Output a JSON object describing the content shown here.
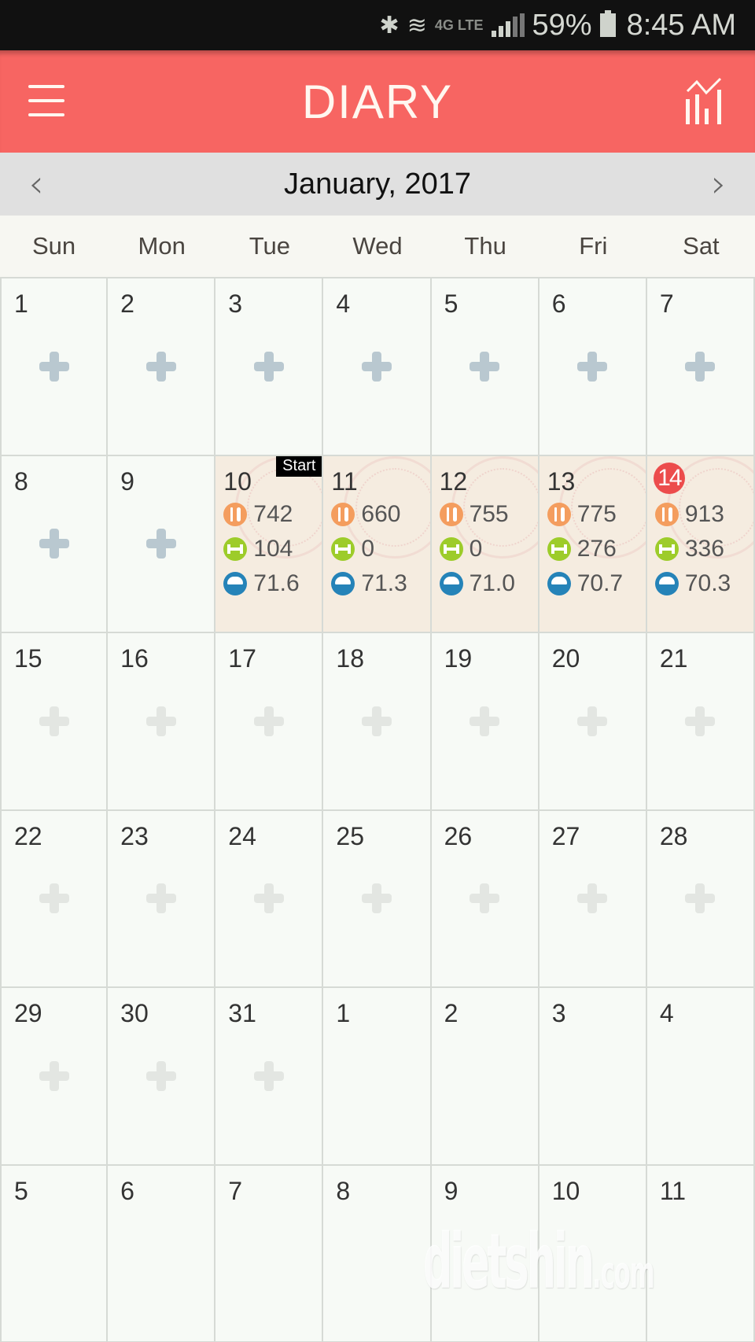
{
  "status_bar": {
    "battery": "59%",
    "time": "8:45 AM",
    "network": "4G LTE",
    "icons": [
      "bluetooth-icon",
      "wifi-icon",
      "lte-icon",
      "signal-icon",
      "battery-icon"
    ]
  },
  "app_bar": {
    "title": "DIARY",
    "menu_icon": "hamburger-menu-icon",
    "stats_icon": "bar-chart-trend-icon",
    "color": "#f76562"
  },
  "month_nav": {
    "label": "January, 2017",
    "prev": "‹",
    "next": "›"
  },
  "weekdays": [
    "Sun",
    "Mon",
    "Tue",
    "Wed",
    "Thu",
    "Fri",
    "Sat"
  ],
  "start_label": "Start",
  "today": 14,
  "cells": [
    {
      "day": "1",
      "plus": "normal"
    },
    {
      "day": "2",
      "plus": "normal"
    },
    {
      "day": "3",
      "plus": "normal"
    },
    {
      "day": "4",
      "plus": "normal"
    },
    {
      "day": "5",
      "plus": "normal"
    },
    {
      "day": "6",
      "plus": "normal"
    },
    {
      "day": "7",
      "plus": "normal"
    },
    {
      "day": "8",
      "plus": "normal"
    },
    {
      "day": "9",
      "plus": "normal"
    },
    {
      "day": "10",
      "start": true,
      "food": "742",
      "exercise": "104",
      "weight": "71.6"
    },
    {
      "day": "11",
      "food": "660",
      "exercise": "0",
      "weight": "71.3"
    },
    {
      "day": "12",
      "food": "755",
      "exercise": "0",
      "weight": "71.0"
    },
    {
      "day": "13",
      "food": "775",
      "exercise": "276",
      "weight": "70.7"
    },
    {
      "day": "14",
      "today": true,
      "food": "913",
      "exercise": "336",
      "weight": "70.3"
    },
    {
      "day": "15",
      "plus": "faded"
    },
    {
      "day": "16",
      "plus": "faded"
    },
    {
      "day": "17",
      "plus": "faded"
    },
    {
      "day": "18",
      "plus": "faded"
    },
    {
      "day": "19",
      "plus": "faded"
    },
    {
      "day": "20",
      "plus": "faded"
    },
    {
      "day": "21",
      "plus": "faded"
    },
    {
      "day": "22",
      "plus": "faded"
    },
    {
      "day": "23",
      "plus": "faded"
    },
    {
      "day": "24",
      "plus": "faded"
    },
    {
      "day": "25",
      "plus": "faded"
    },
    {
      "day": "26",
      "plus": "faded"
    },
    {
      "day": "27",
      "plus": "faded"
    },
    {
      "day": "28",
      "plus": "faded"
    },
    {
      "day": "29",
      "plus": "faded"
    },
    {
      "day": "30",
      "plus": "faded"
    },
    {
      "day": "31",
      "plus": "faded"
    },
    {
      "day": "1",
      "other": true
    },
    {
      "day": "2",
      "other": true
    },
    {
      "day": "3",
      "other": true
    },
    {
      "day": "4",
      "other": true
    },
    {
      "day": "5",
      "other": true
    },
    {
      "day": "6",
      "other": true
    },
    {
      "day": "7",
      "other": true
    },
    {
      "day": "8",
      "other": true
    },
    {
      "day": "9",
      "other": true
    },
    {
      "day": "10",
      "other": true
    },
    {
      "day": "11",
      "other": true
    }
  ],
  "watermark": {
    "main": "dietshin",
    "suffix": ".com"
  }
}
